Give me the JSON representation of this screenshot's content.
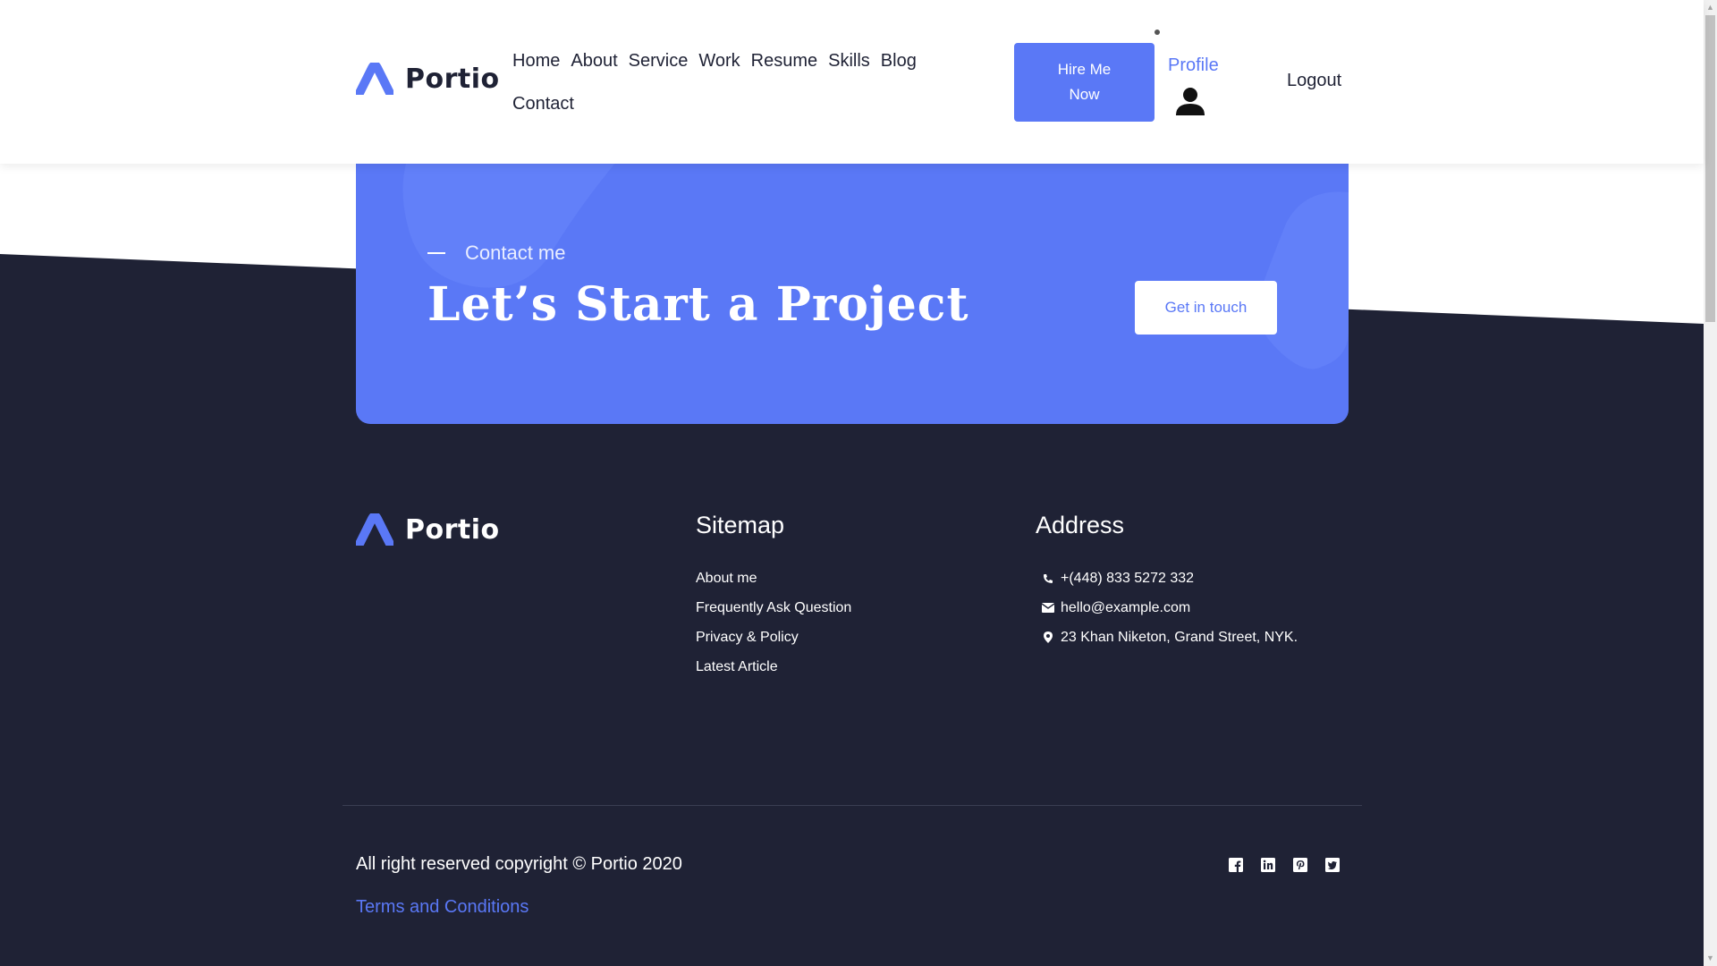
{
  "brand": {
    "name": "Portio",
    "accent": "#5a78f6",
    "dark": "#1f2235"
  },
  "nav": {
    "items": [
      {
        "label": "Home"
      },
      {
        "label": "About"
      },
      {
        "label": "Service"
      },
      {
        "label": "Work"
      },
      {
        "label": "Resume"
      },
      {
        "label": "Skills"
      },
      {
        "label": "Blog"
      },
      {
        "label": "Contact"
      }
    ],
    "hire_label": "Hire Me Now",
    "profile_label": "Profile",
    "logout_label": "Logout"
  },
  "cta": {
    "label": "Contact me",
    "title": "Let’s Start a Project",
    "button_label": "Get in touch"
  },
  "footer": {
    "sitemap": {
      "title": "Sitemap",
      "links": [
        {
          "label": "About me"
        },
        {
          "label": "Frequently Ask Question"
        },
        {
          "label": "Privacy & Policy"
        },
        {
          "label": "Latest Article"
        }
      ]
    },
    "address": {
      "title": "Address",
      "items": [
        {
          "icon": "phone-icon",
          "text": "+(448) 833 5272 332"
        },
        {
          "icon": "mail-icon",
          "text": "hello@example.com"
        },
        {
          "icon": "location-pin-icon",
          "text": "23 Khan Niketon, Grand Street, NYK."
        }
      ]
    },
    "copyright": "All right reserved copyright © Portio 2020",
    "terms_label": "Terms and Conditions",
    "socials": [
      "facebook-icon",
      "linkedin-icon",
      "pinterest-icon",
      "twitter-icon"
    ]
  }
}
